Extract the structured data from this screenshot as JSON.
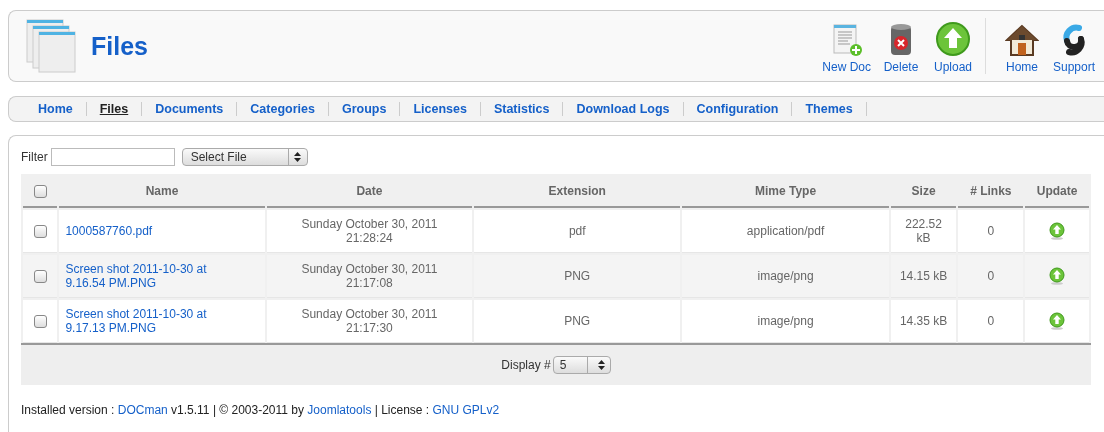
{
  "header": {
    "title": "Files"
  },
  "toolbar": [
    [
      {
        "kind": "new-doc",
        "label": "New Doc"
      },
      {
        "kind": "delete",
        "label": "Delete"
      },
      {
        "kind": "upload",
        "label": "Upload"
      }
    ],
    [
      {
        "kind": "home",
        "label": "Home"
      },
      {
        "kind": "support",
        "label": "Support"
      }
    ]
  ],
  "tabs": [
    {
      "label": "Home",
      "selected": false
    },
    {
      "label": "Files",
      "selected": true
    },
    {
      "label": "Documents",
      "selected": false
    },
    {
      "label": "Categories",
      "selected": false
    },
    {
      "label": "Groups",
      "selected": false
    },
    {
      "label": "Licenses",
      "selected": false
    },
    {
      "label": "Statistics",
      "selected": false
    },
    {
      "label": "Download Logs",
      "selected": false
    },
    {
      "label": "Configuration",
      "selected": false
    },
    {
      "label": "Themes",
      "selected": false
    }
  ],
  "filter": {
    "label": "Filter",
    "select": "Select File"
  },
  "table": {
    "select_all_checked": false,
    "columns": [
      "Name",
      "Date",
      "Extension",
      "Mime Type",
      "Size",
      "# Links",
      "Update"
    ],
    "rows": [
      {
        "checked": false,
        "name": "1000587760.pdf",
        "date": "Sunday October 30, 2011 21:28:24",
        "extension": "pdf",
        "mime": "application/pdf",
        "size": "222.52 kB",
        "links": "0"
      },
      {
        "checked": false,
        "name": "Screen shot 2011-10-30 at 9.16.54 PM.PNG",
        "date": "Sunday October 30, 2011 21:17:08",
        "extension": "PNG",
        "mime": "image/png",
        "size": "14.15 kB",
        "links": "0"
      },
      {
        "checked": false,
        "name": "Screen shot 2011-10-30 at 9.17.13 PM.PNG",
        "date": "Sunday October 30, 2011 21:17:30",
        "extension": "PNG",
        "mime": "image/png",
        "size": "14.35 kB",
        "links": "0"
      }
    ],
    "display": {
      "label": "Display #",
      "value": "5"
    }
  },
  "footer": [
    {
      "kind": "text",
      "text": "Installed version : "
    },
    {
      "kind": "link",
      "text": "DOCman"
    },
    {
      "kind": "text",
      "text": " v1.5.11 | © 2003-2011 by "
    },
    {
      "kind": "link",
      "text": "Joomlatools"
    },
    {
      "kind": "text",
      "text": " | License : "
    },
    {
      "kind": "link",
      "text": "GNU GPLv2"
    }
  ]
}
